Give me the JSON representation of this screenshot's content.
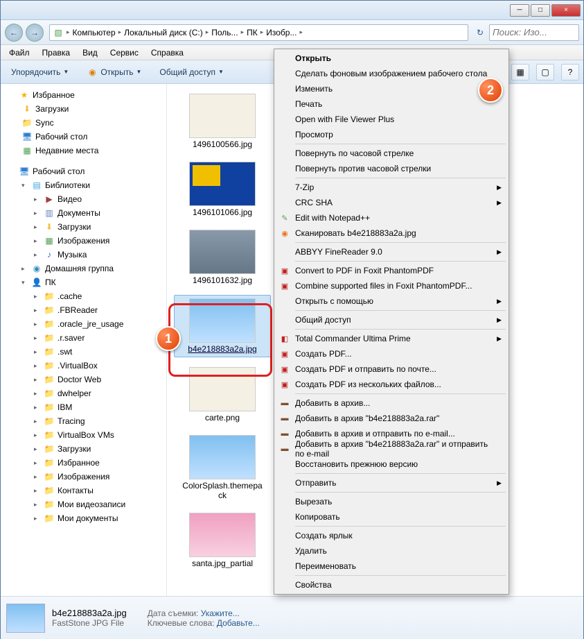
{
  "titlebar": {
    "min": "─",
    "max": "□",
    "close": "×"
  },
  "nav": {
    "back": "←",
    "fwd": "→",
    "crumbs": [
      "Компьютер",
      "Локальный диск (C:)",
      "Поль...",
      "ПК",
      "Изобр..."
    ],
    "refresh": "↻",
    "search_placeholder": "Поиск: Изо..."
  },
  "menu": {
    "file": "Файл",
    "edit": "Правка",
    "view": "Вид",
    "service": "Сервис",
    "help": "Справка"
  },
  "toolbar": {
    "organize": "Упорядочить",
    "open": "Открыть",
    "share": "Общий доступ",
    "views_icon": "▦",
    "preview_icon": "▢",
    "help_icon": "?"
  },
  "sidebar": {
    "favorites": {
      "label": "Избранное",
      "items": [
        "Загрузки",
        "Sync",
        "Рабочий стол",
        "Недавние места"
      ]
    },
    "desktop": {
      "label": "Рабочий стол",
      "libraries": {
        "label": "Библиотеки",
        "items": [
          "Видео",
          "Документы",
          "Загрузки",
          "Изображения",
          "Музыка"
        ]
      },
      "homegroup": "Домашняя группа",
      "user": {
        "label": "ПК",
        "items": [
          ".cache",
          ".FBReader",
          ".oracle_jre_usage",
          ".r.saver",
          ".swt",
          ".VirtualBox",
          "Doctor Web",
          "dwhelper",
          "IBM",
          "Tracing",
          "VirtualBox VMs",
          "Загрузки",
          "Избранное",
          "Изображения",
          "Контакты",
          "Мои видеозаписи",
          "Мои документы"
        ]
      }
    }
  },
  "files": [
    {
      "name": "1496100566.jpg",
      "style": "map"
    },
    {
      "name": "1496101066.jpg",
      "style": "flag"
    },
    {
      "name": "1496101632.jpg",
      "style": "people"
    },
    {
      "name": "b4e218883a2a.jpg",
      "style": "blue",
      "selected": true
    },
    {
      "name": "carte.png",
      "style": "map"
    },
    {
      "name": "ColorSplash.themepack",
      "style": "blue"
    },
    {
      "name": "santa.jpg_partial",
      "style": "santa"
    }
  ],
  "details": {
    "name": "b4e218883a2a.jpg",
    "type": "FastStone JPG File",
    "date_label": "Дата съемки:",
    "date_val": "Укажите...",
    "keys_label": "Ключевые слова:",
    "keys_val": "Добавьте..."
  },
  "ctx": {
    "open": "Открыть",
    "setbg": "Сделать фоновым изображением рабочего стола",
    "edit": "Изменить",
    "print": "Печать",
    "fvp": "Open with File Viewer Plus",
    "view": "Просмотр",
    "rotr": "Повернуть по часовой стрелке",
    "rotl": "Повернуть против часовой стрелки",
    "sevenzip": "7-Zip",
    "crc": "CRC SHA",
    "npp": "Edit with Notepad++",
    "avast": "Сканировать b4e218883a2a.jpg",
    "abbyy": "ABBYY FineReader 9.0",
    "foxit1": "Convert to PDF in Foxit PhantomPDF",
    "foxit2": "Combine supported files in Foxit PhantomPDF...",
    "openwith": "Открыть с помощью",
    "share": "Общий доступ",
    "tc": "Total Commander Ultima Prime",
    "pdf1": "Создать PDF...",
    "pdf2": "Создать PDF и отправить по почте...",
    "pdf3": "Создать PDF из нескольких файлов...",
    "rar1": "Добавить в архив...",
    "rar2": "Добавить в архив \"b4e218883a2a.rar\"",
    "rar3": "Добавить в архив и отправить по e-mail...",
    "rar4": "Добавить в архив \"b4e218883a2a.rar\" и отправить по e-mail",
    "restore": "Восстановить прежнюю версию",
    "sendto": "Отправить",
    "cut": "Вырезать",
    "copy": "Копировать",
    "shortcut": "Создать ярлык",
    "delete": "Удалить",
    "rename": "Переименовать",
    "props": "Свойства"
  },
  "badges": {
    "one": "1",
    "two": "2"
  }
}
